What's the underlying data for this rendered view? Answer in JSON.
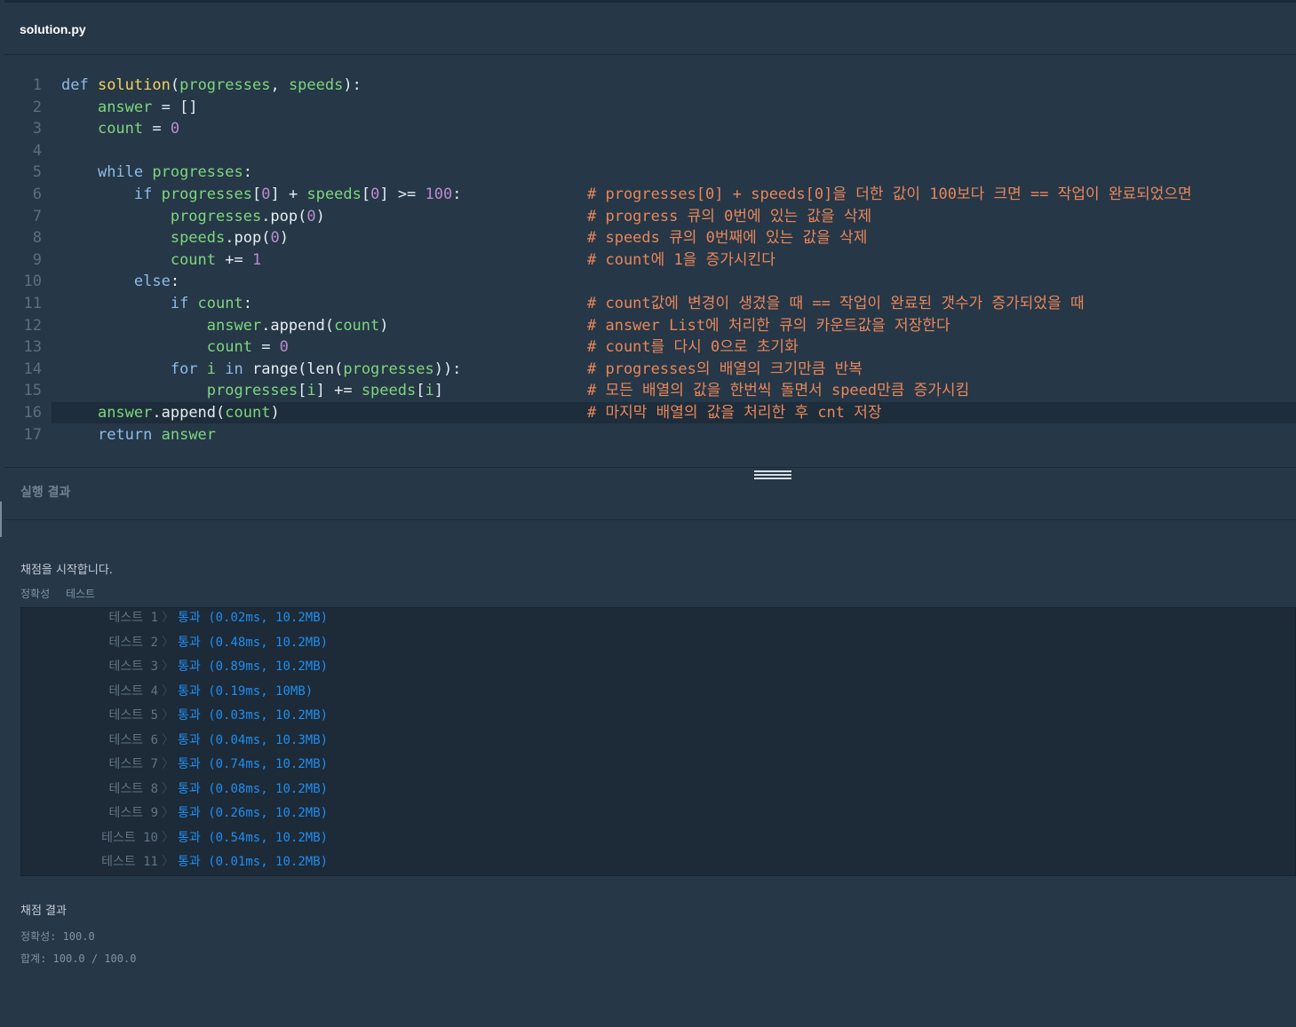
{
  "file_tab": {
    "title": "solution.py"
  },
  "code_lines": [
    {
      "n": "1",
      "segs": [
        [
          "kw",
          "def "
        ],
        [
          "fn",
          "solution"
        ],
        [
          "op",
          "("
        ],
        [
          "id",
          "progresses"
        ],
        [
          "op",
          ", "
        ],
        [
          "id",
          "speeds"
        ],
        [
          "op",
          "):"
        ]
      ],
      "comment": ""
    },
    {
      "n": "2",
      "segs": [
        [
          "op",
          "    "
        ],
        [
          "id",
          "answer"
        ],
        [
          "op",
          " = []"
        ]
      ],
      "comment": ""
    },
    {
      "n": "3",
      "segs": [
        [
          "op",
          "    "
        ],
        [
          "id",
          "count"
        ],
        [
          "op",
          " = "
        ],
        [
          "num",
          "0"
        ]
      ],
      "comment": ""
    },
    {
      "n": "4",
      "segs": [],
      "comment": ""
    },
    {
      "n": "5",
      "segs": [
        [
          "op",
          "    "
        ],
        [
          "kw",
          "while "
        ],
        [
          "id",
          "progresses"
        ],
        [
          "op",
          ":"
        ]
      ],
      "comment": ""
    },
    {
      "n": "6",
      "segs": [
        [
          "op",
          "        "
        ],
        [
          "kw",
          "if "
        ],
        [
          "id",
          "progresses"
        ],
        [
          "op",
          "["
        ],
        [
          "num",
          "0"
        ],
        [
          "op",
          "] + "
        ],
        [
          "id",
          "speeds"
        ],
        [
          "op",
          "["
        ],
        [
          "num",
          "0"
        ],
        [
          "op",
          "] >= "
        ],
        [
          "num",
          "100"
        ],
        [
          "op",
          ":"
        ]
      ],
      "comment": "# progresses[0] + speeds[0]을 더한 값이 100보다 크면 == 작업이 완료되었으면"
    },
    {
      "n": "7",
      "segs": [
        [
          "op",
          "            "
        ],
        [
          "id",
          "progresses"
        ],
        [
          "op",
          ".pop("
        ],
        [
          "num",
          "0"
        ],
        [
          "op",
          ")"
        ]
      ],
      "comment": "# progress 큐의 0번에 있는 값을 삭제"
    },
    {
      "n": "8",
      "segs": [
        [
          "op",
          "            "
        ],
        [
          "id",
          "speeds"
        ],
        [
          "op",
          ".pop("
        ],
        [
          "num",
          "0"
        ],
        [
          "op",
          ")"
        ]
      ],
      "comment": "# speeds 큐의 0번째에 있는 값을 삭제"
    },
    {
      "n": "9",
      "segs": [
        [
          "op",
          "            "
        ],
        [
          "id",
          "count"
        ],
        [
          "op",
          " += "
        ],
        [
          "num",
          "1"
        ]
      ],
      "comment": "# count에 1을 증가시킨다"
    },
    {
      "n": "10",
      "segs": [
        [
          "op",
          "        "
        ],
        [
          "kw",
          "else"
        ],
        [
          "op",
          ":"
        ]
      ],
      "comment": ""
    },
    {
      "n": "11",
      "segs": [
        [
          "op",
          "            "
        ],
        [
          "kw",
          "if "
        ],
        [
          "id",
          "count"
        ],
        [
          "op",
          ":"
        ]
      ],
      "comment": "# count값에 변경이 생겼을 때 == 작업이 완료된 갯수가 증가되었을 때"
    },
    {
      "n": "12",
      "segs": [
        [
          "op",
          "                "
        ],
        [
          "id",
          "answer"
        ],
        [
          "op",
          ".append("
        ],
        [
          "id",
          "count"
        ],
        [
          "op",
          ")"
        ]
      ],
      "comment": "# answer List에 처리한 큐의 카운트값을 저장한다"
    },
    {
      "n": "13",
      "segs": [
        [
          "op",
          "                "
        ],
        [
          "id",
          "count"
        ],
        [
          "op",
          " = "
        ],
        [
          "num",
          "0"
        ]
      ],
      "comment": "# count를 다시 0으로 초기화"
    },
    {
      "n": "14",
      "segs": [
        [
          "op",
          "            "
        ],
        [
          "kw",
          "for "
        ],
        [
          "id",
          "i"
        ],
        [
          "kw",
          " in "
        ],
        [
          "op",
          "range(len("
        ],
        [
          "id",
          "progresses"
        ],
        [
          "op",
          ")):"
        ]
      ],
      "comment": "# progresses의 배열의 크기만큼 반복"
    },
    {
      "n": "15",
      "segs": [
        [
          "op",
          "                "
        ],
        [
          "id",
          "progresses"
        ],
        [
          "op",
          "["
        ],
        [
          "id",
          "i"
        ],
        [
          "op",
          "] += "
        ],
        [
          "id",
          "speeds"
        ],
        [
          "op",
          "["
        ],
        [
          "id",
          "i"
        ],
        [
          "op",
          "]"
        ]
      ],
      "comment": "# 모든 배열의 값을 한번씩 돌면서 speed만큼 증가시킴"
    },
    {
      "n": "16",
      "segs": [
        [
          "op",
          "    "
        ],
        [
          "id",
          "answer"
        ],
        [
          "op",
          ".append("
        ],
        [
          "id",
          "count"
        ],
        [
          "op",
          ")"
        ]
      ],
      "comment": "# 마지막 배열의 값을 처리한 후 cnt 저장",
      "active": true
    },
    {
      "n": "17",
      "segs": [
        [
          "op",
          "    "
        ],
        [
          "kw",
          "return "
        ],
        [
          "id",
          "answer"
        ]
      ],
      "comment": ""
    }
  ],
  "result_panel": {
    "title": "실행 결과",
    "start_message": "채점을 시작합니다.",
    "tabs": [
      "정확성",
      "테스트"
    ],
    "tests": [
      {
        "label": "테스트 1",
        "result": "통과 (0.02ms, 10.2MB)"
      },
      {
        "label": "테스트 2",
        "result": "통과 (0.48ms, 10.2MB)"
      },
      {
        "label": "테스트 3",
        "result": "통과 (0.89ms, 10.2MB)"
      },
      {
        "label": "테스트 4",
        "result": "통과 (0.19ms, 10MB)"
      },
      {
        "label": "테스트 5",
        "result": "통과 (0.03ms, 10.2MB)"
      },
      {
        "label": "테스트 6",
        "result": "통과 (0.04ms, 10.3MB)"
      },
      {
        "label": "테스트 7",
        "result": "통과 (0.74ms, 10.2MB)"
      },
      {
        "label": "테스트 8",
        "result": "통과 (0.08ms, 10.2MB)"
      },
      {
        "label": "테스트 9",
        "result": "통과 (0.26ms, 10.2MB)"
      },
      {
        "label": "테스트 10",
        "result": "통과 (0.54ms, 10.2MB)"
      },
      {
        "label": "테스트 11",
        "result": "통과 (0.01ms, 10.2MB)"
      }
    ],
    "separator": "〉",
    "score_title": "채점 결과",
    "accuracy": "정확성: 100.0",
    "total": "합계: 100.0 / 100.0"
  }
}
